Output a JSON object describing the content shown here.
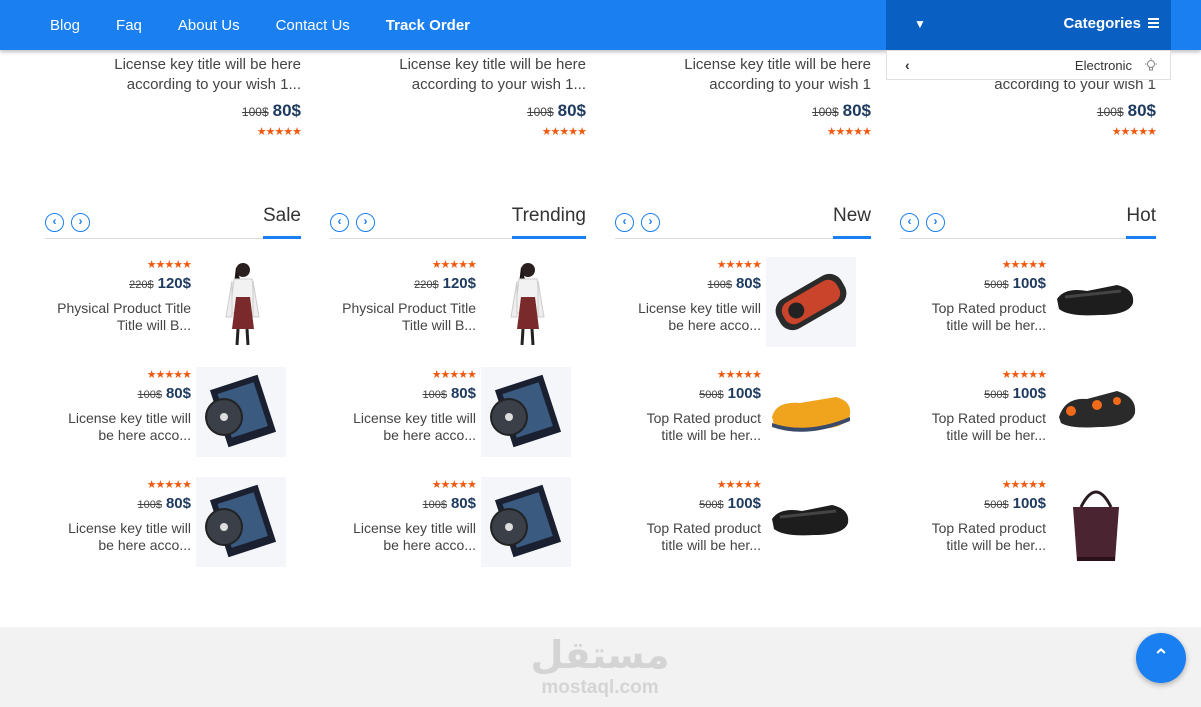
{
  "nav": {
    "links": [
      "Blog",
      "Faq",
      "About Us",
      "Contact Us",
      "Track Order"
    ],
    "categories_label": "Categories",
    "dropdown_item": "Electronic"
  },
  "top_products": [
    {
      "title1": "License key title will be here",
      "title2": "according to your wish 1...",
      "old_price": "100$",
      "price": "80$",
      "rating": 5
    },
    {
      "title1": "License key title will be here",
      "title2": "according to your wish 1...",
      "old_price": "100$",
      "price": "80$",
      "rating": 5
    },
    {
      "title1": "License key title will be here",
      "title2": "according to your wish 1",
      "old_price": "100$",
      "price": "80$",
      "rating": 5
    },
    {
      "title1": "",
      "title2": "according to your wish 1",
      "old_price": "100$",
      "price": "80$",
      "rating": 5
    }
  ],
  "sections": [
    {
      "title": "Sale",
      "items": [
        {
          "old_price": "220$",
          "price": "120$",
          "title1": "Physical Product Title",
          "title2": "Title will B...",
          "image": "woman-in-dress"
        },
        {
          "old_price": "100$",
          "price": "80$",
          "title1": "License key title will",
          "title2": "be here acco...",
          "image": "dvd-case"
        },
        {
          "old_price": "100$",
          "price": "80$",
          "title1": "License key title will",
          "title2": "be here acco...",
          "image": "dvd-case"
        }
      ]
    },
    {
      "title": "Trending",
      "items": [
        {
          "old_price": "220$",
          "price": "120$",
          "title1": "Physical Product Title",
          "title2": "Title will B...",
          "image": "woman-in-dress"
        },
        {
          "old_price": "100$",
          "price": "80$",
          "title1": "License key title will",
          "title2": "be here acco...",
          "image": "dvd-case"
        },
        {
          "old_price": "100$",
          "price": "80$",
          "title1": "License key title will",
          "title2": "be here acco...",
          "image": "dvd-case"
        }
      ]
    },
    {
      "title": "New",
      "items": [
        {
          "old_price": "100$",
          "price": "80$",
          "title1": "License key title will",
          "title2": "be here acco...",
          "image": "game-disc"
        },
        {
          "old_price": "500$",
          "price": "100$",
          "title1": "Top Rated product",
          "title2": "title will be her...",
          "image": "yellow-shoe"
        },
        {
          "old_price": "500$",
          "price": "100$",
          "title1": "Top Rated product",
          "title2": "title will be her...",
          "image": "black-shoe"
        }
      ]
    },
    {
      "title": "Hot",
      "items": [
        {
          "old_price": "500$",
          "price": "100$",
          "title1": "Top Rated product",
          "title2": "title will be her...",
          "image": "black-shoe"
        },
        {
          "old_price": "500$",
          "price": "100$",
          "title1": "Top Rated product",
          "title2": "title will be her...",
          "image": "orange-shoe"
        },
        {
          "old_price": "500$",
          "price": "100$",
          "title1": "Top Rated product",
          "title2": "title will be her...",
          "image": "handbag"
        }
      ]
    }
  ],
  "stars_text": "★★★★★",
  "footer": {
    "watermark_ar": "مستقل",
    "watermark_en": "mostaql.com"
  },
  "colors": {
    "primary": "#1a7ff0",
    "dark_primary": "#0a5fc2",
    "star": "#f05a10"
  }
}
